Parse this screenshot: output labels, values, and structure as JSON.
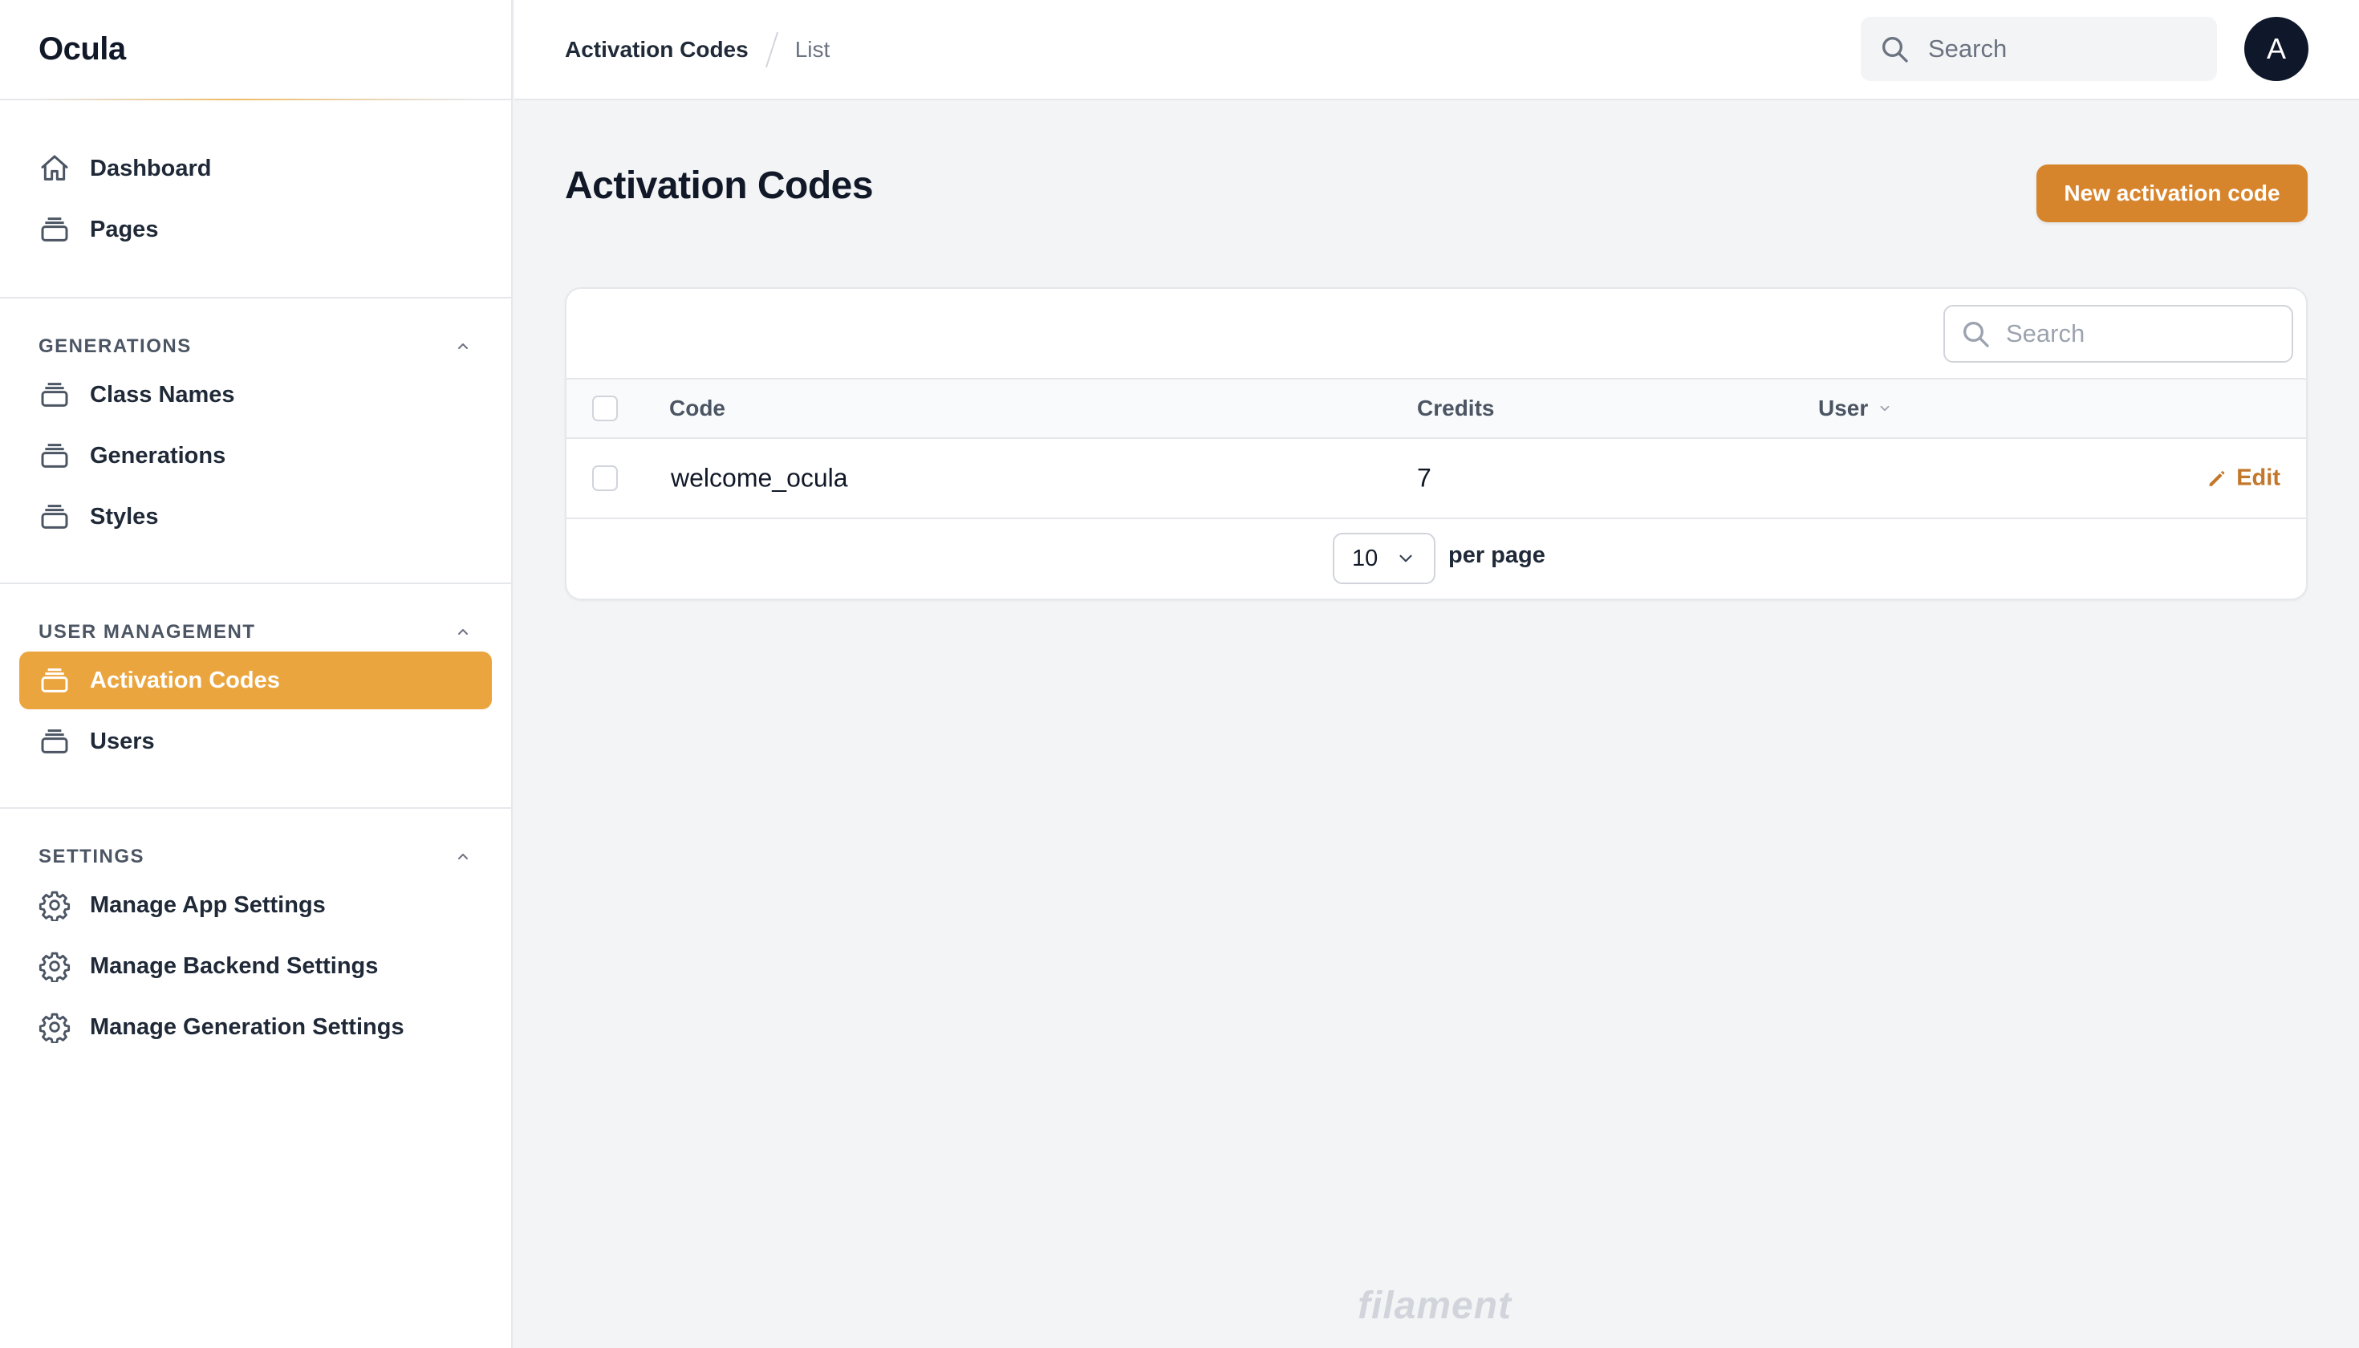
{
  "app": {
    "brand": "Ocula"
  },
  "colors": {
    "accent": "#eba53f",
    "primary_button": "#d7852c",
    "link": "#c2772a"
  },
  "sidebar": {
    "top_items": [
      {
        "label": "Dashboard",
        "icon": "home-icon"
      },
      {
        "label": "Pages",
        "icon": "collection-icon"
      }
    ],
    "sections": [
      {
        "label": "GENERATIONS",
        "items": [
          {
            "label": "Class Names",
            "icon": "collection-icon"
          },
          {
            "label": "Generations",
            "icon": "collection-icon"
          },
          {
            "label": "Styles",
            "icon": "collection-icon"
          }
        ]
      },
      {
        "label": "USER MANAGEMENT",
        "items": [
          {
            "label": "Activation Codes",
            "icon": "collection-icon",
            "active": true
          },
          {
            "label": "Users",
            "icon": "collection-icon"
          }
        ]
      },
      {
        "label": "SETTINGS",
        "items": [
          {
            "label": "Manage App Settings",
            "icon": "gear-icon"
          },
          {
            "label": "Manage Backend Settings",
            "icon": "gear-icon"
          },
          {
            "label": "Manage Generation Settings",
            "icon": "gear-icon"
          }
        ]
      }
    ]
  },
  "header": {
    "breadcrumb": [
      "Activation Codes",
      "List"
    ],
    "search_placeholder": "Search",
    "avatar_initial": "A"
  },
  "main": {
    "title": "Activation Codes",
    "new_button_label": "New activation code",
    "table": {
      "search_placeholder": "Search",
      "columns": [
        "Code",
        "Credits",
        "User"
      ],
      "rows": [
        {
          "code": "welcome_ocula",
          "credits": "7",
          "user": "",
          "action": "Edit"
        }
      ],
      "per_page_value": "10",
      "per_page_label": "per page"
    }
  },
  "footer": {
    "logo": "filament"
  }
}
